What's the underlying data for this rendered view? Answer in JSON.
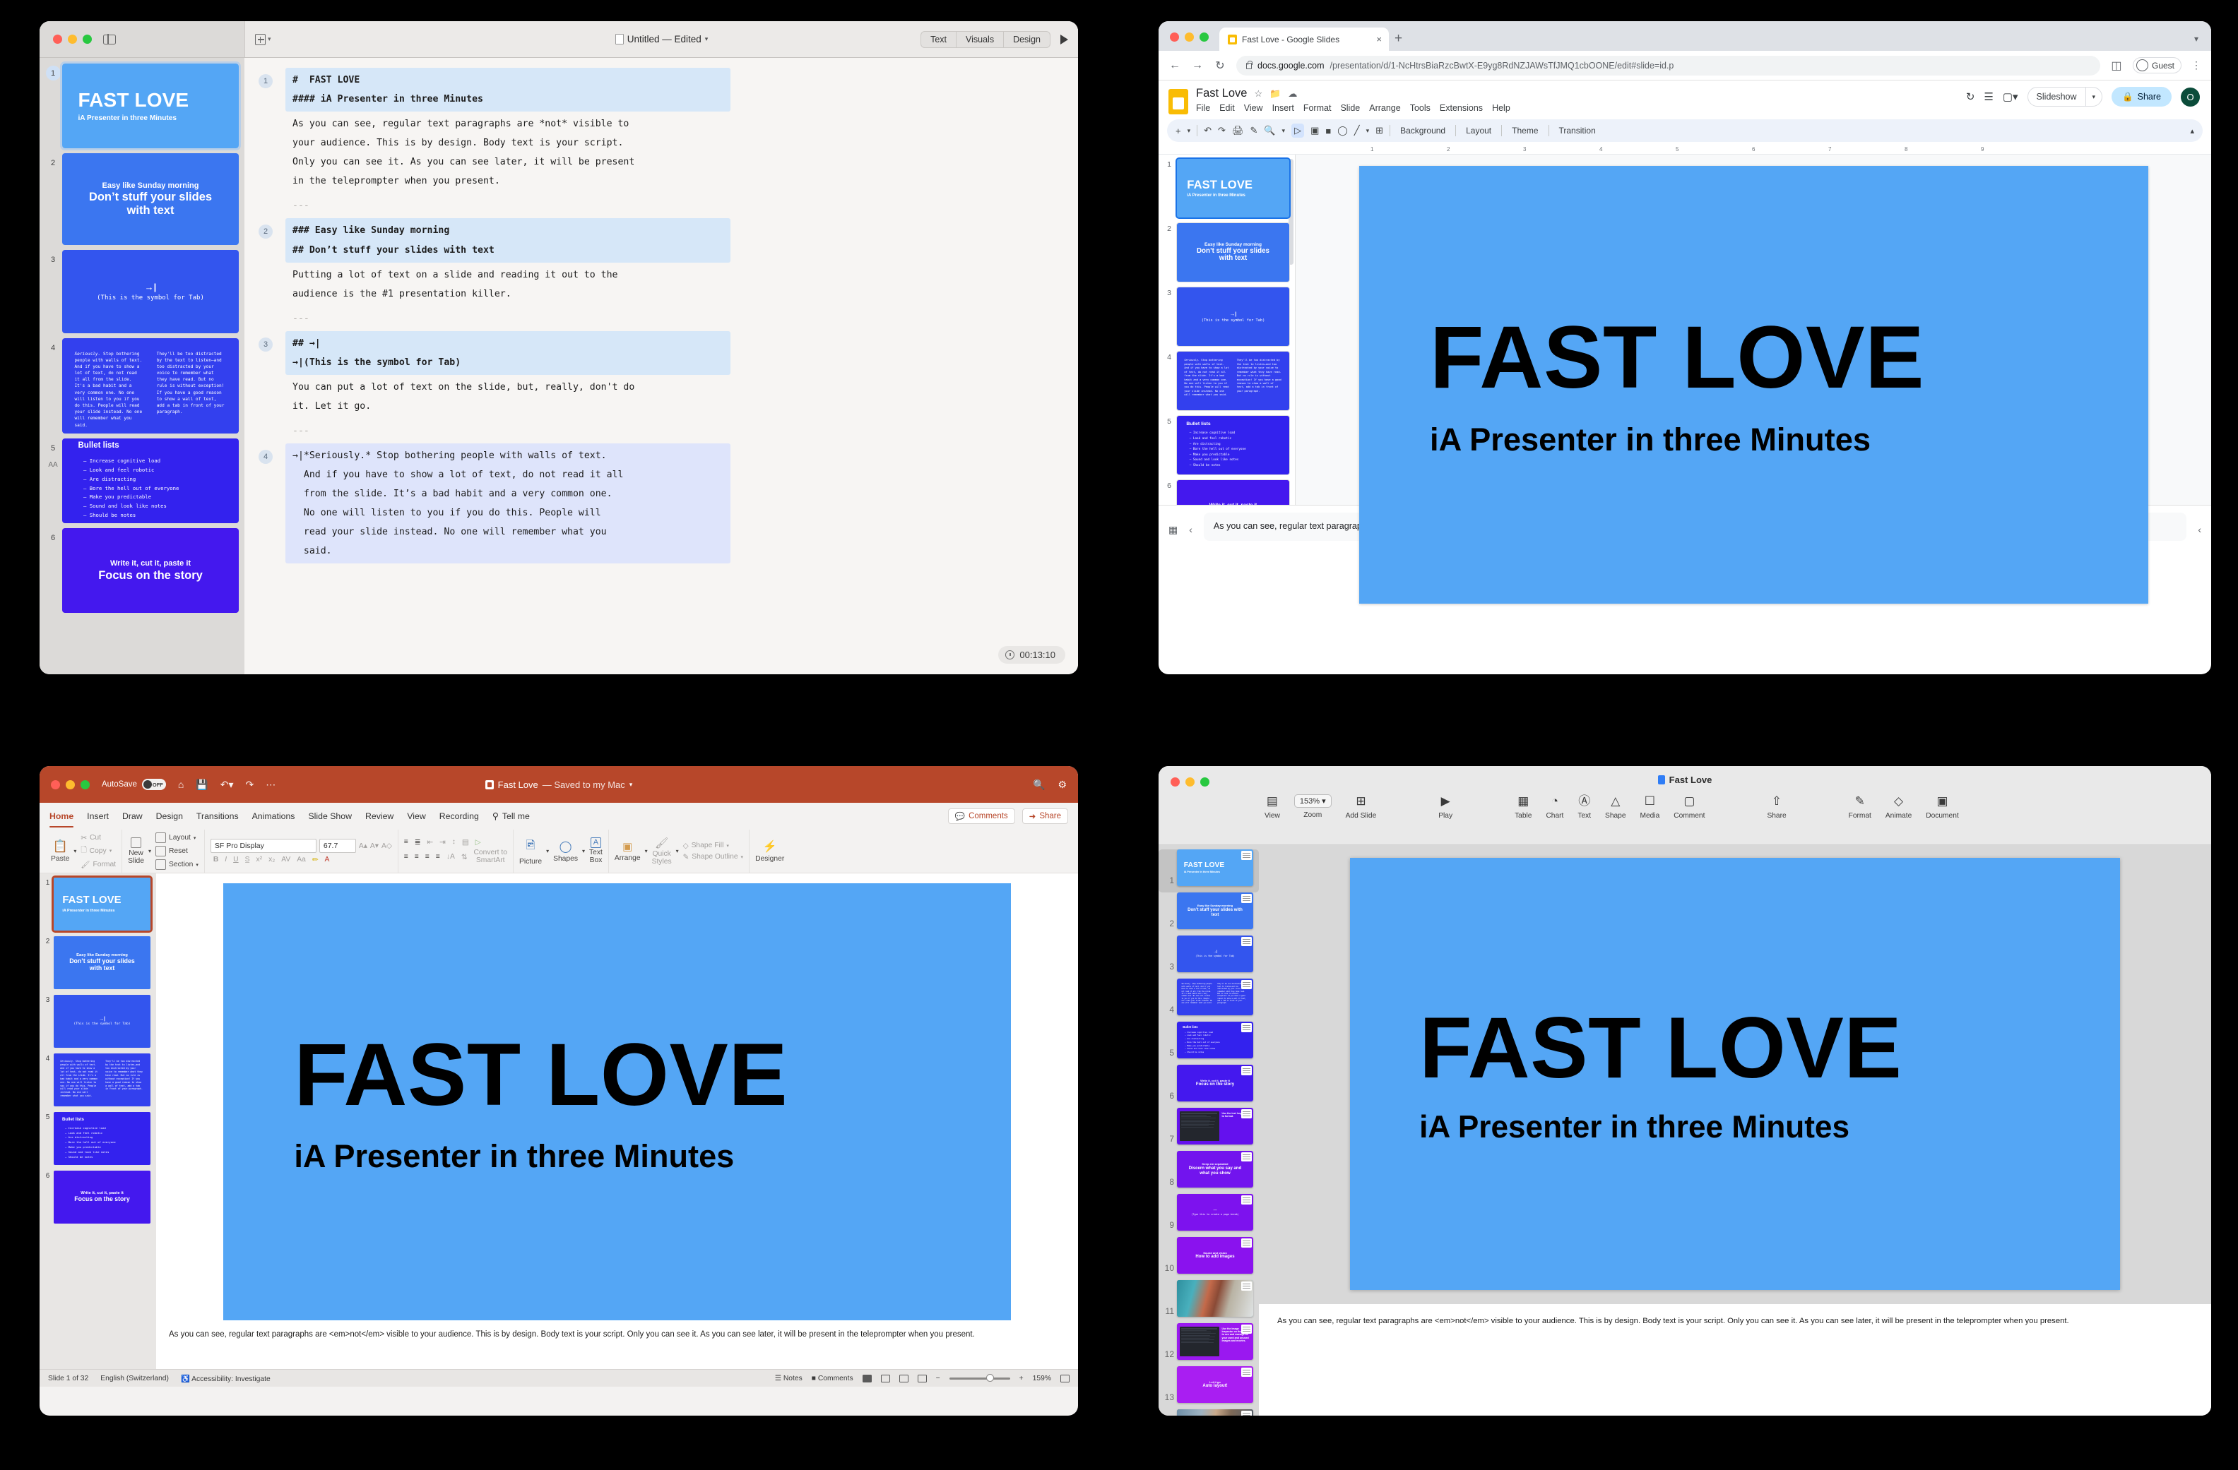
{
  "deck": {
    "slides": [
      {
        "n": 1,
        "bg": "#54a6f5",
        "kind": "title",
        "title": "FAST LOVE",
        "subtitle": "iA Presenter in three Minutes"
      },
      {
        "n": 2,
        "bg": "#3b76f0",
        "kind": "two-heading",
        "small": "Easy like Sunday morning",
        "big": "Don’t stuff your slides with text"
      },
      {
        "n": 3,
        "bg": "#3355ee",
        "kind": "tab",
        "symbol": "→|",
        "caption": "(This is the symbol for Tab)"
      },
      {
        "n": 4,
        "bg": "#3340ee",
        "kind": "two-col",
        "left": "Seriously. Stop bothering people with walls of text. And if you have to show a lot of text, do not read it all from the slide. It's a bad habit and a very common one. No one will listen to you if you do this. People will read your slide instead. No one will remember what you said.",
        "right": "They'll be too distracted by the text to listen—and too distracted by your voice to remember what they have read. But no rule is without exception! If you have a good reason to show a wall of text, add a tab in front of your paragraph."
      },
      {
        "n": 5,
        "bg": "#3322ee",
        "kind": "bullets",
        "heading": "Bullet lists",
        "items": [
          "Increase cognitive load",
          "Look and feel robotic",
          "Are distracting",
          "Bore the hell out of everyone",
          "Make you predictable",
          "Sound and look like notes",
          "Should be notes"
        ]
      },
      {
        "n": 6,
        "bg": "#4418ee",
        "kind": "two-heading",
        "small": "Write it, cut it, paste it",
        "big": "Focus on the story"
      },
      {
        "n": 7,
        "bg": "#6411ee",
        "kind": "dark-split",
        "text": "Use the text Inspector to format."
      },
      {
        "n": 8,
        "bg": "#7214ee",
        "kind": "two-heading",
        "small": "Keep em separated",
        "big": "Discern what you say and what you show"
      },
      {
        "n": 9,
        "bg": "#7d12ee",
        "kind": "tab",
        "symbol": "---",
        "caption": "(Type this to create a page break)"
      },
      {
        "n": 10,
        "bg": "#8a12ee",
        "kind": "two-heading",
        "small": "Sound and vision",
        "big": "How to add images"
      },
      {
        "n": 11,
        "bg": "#3a7f8c",
        "kind": "photo",
        "photo": "bridge"
      },
      {
        "n": 12,
        "bg": "#9a18f0",
        "kind": "dark-split",
        "text": "Use the image Inspector on the right to see and manage all your used and unused images and movies."
      },
      {
        "n": 13,
        "bg": "#a91ef2",
        "kind": "two-heading",
        "small": "Let it go",
        "big": "Auto layout!"
      },
      {
        "n": 14,
        "bg": "#4a6d80",
        "kind": "photo",
        "photo": "city"
      }
    ]
  },
  "ia": {
    "window_name": "iA Presenter",
    "titlebar": {
      "new_doc_label": "",
      "doc_title": "Untitled — Edited",
      "segments": [
        "Text",
        "Visuals",
        "Design"
      ],
      "play_icon": "play-icon"
    },
    "timer": "00:13:10",
    "editor": {
      "blocks": [
        {
          "num": "1",
          "hl": true,
          "lines": [
            "#  FAST LOVE",
            "#### iA Presenter in three Minutes"
          ]
        },
        {
          "num": "",
          "hl": false,
          "lines": [
            "As you can see, regular text paragraphs are *not* visible to",
            "your audience. This is by design. Body text is your script.",
            "Only you can see it. As you can see later, it will be present",
            "in the teleprompter when you present."
          ]
        },
        {
          "num": "",
          "hl": false,
          "lines": [
            "---"
          ],
          "dim": true
        },
        {
          "num": "2",
          "hl": true,
          "lines": [
            "### Easy like Sunday morning",
            "## Don’t stuff your slides with text"
          ]
        },
        {
          "num": "",
          "hl": false,
          "lines": [
            "Putting a lot of text on a slide and reading it out to the",
            "audience is the #1 presentation killer."
          ]
        },
        {
          "num": "",
          "hl": false,
          "lines": [
            "---"
          ],
          "dim": true
        },
        {
          "num": "3",
          "hl": true,
          "lines": [
            "## →|",
            "→|(This is the symbol for Tab)"
          ]
        },
        {
          "num": "",
          "hl": false,
          "lines": [
            "You can put a lot of text on the slide, but, really, don't do",
            "it. Let it go."
          ]
        },
        {
          "num": "",
          "hl": false,
          "lines": [
            "---"
          ],
          "dim": true
        },
        {
          "num": "4",
          "hl2": true,
          "lines": [
            "→|*Seriously.* Stop bothering people with walls of text.",
            "  And if you have to show a lot of text, do not read it all",
            "  from the slide. It’s a bad habit and a very common one.",
            "  No one will listen to you if you do this. People will",
            "  read your slide instead. No one will remember what you",
            "  said."
          ]
        }
      ]
    }
  },
  "gs": {
    "window_name": "Google Chrome — Google Slides",
    "browser": {
      "tab_title": "Fast Love - Google Slides",
      "tab_close": "×",
      "new_tab": "+",
      "back": "←",
      "forward": "→",
      "reload": "↻",
      "url": "docs.google.com",
      "url_path": "/presentation/d/1-NcHtrsBiaRzcBwtX-E9yg8RdNZJAWsTfJMQ1cbOONE/edit#slide=id.p",
      "profile": "Guest",
      "menu": "⋮"
    },
    "app": {
      "doc_title": "Fast Love",
      "menus": [
        "File",
        "Edit",
        "View",
        "Insert",
        "Format",
        "Slide",
        "Arrange",
        "Tools",
        "Extensions",
        "Help"
      ],
      "slideshow_label": "Slideshow",
      "share_label": "Share",
      "avatar_initial": "O",
      "toolbar_labels": [
        "Background",
        "Layout",
        "Theme",
        "Transition"
      ],
      "ruler_ticks": [
        "1",
        "2",
        "3",
        "4",
        "5",
        "6",
        "7",
        "8",
        "9"
      ],
      "notes": "As you can see, regular text paragraphs are <em>not</em> visible to your audience. This is by design. Body text is your script. Only you can see it. As you can see later, it will be present in the teleprompter when you present."
    }
  },
  "pp": {
    "window_name": "Microsoft PowerPoint",
    "titlebar": {
      "autosave_label": "AutoSave",
      "toggle_state": "OFF",
      "doc_name": "Fast Love",
      "doc_status": "— Saved to my Mac",
      "search_icon": "search-icon",
      "settings_icon": "gear-icon"
    },
    "tabs": [
      "Home",
      "Insert",
      "Draw",
      "Design",
      "Transitions",
      "Animations",
      "Slide Show",
      "Review",
      "View",
      "Recording"
    ],
    "tell_me": "Tell me",
    "comments_label": "Comments",
    "share_label": "Share",
    "ribbon": {
      "paste": "Paste",
      "cut": "Cut",
      "copy": "Copy",
      "format": "Format",
      "new_slide": "New\nSlide",
      "layout": "Layout",
      "reset": "Reset",
      "section": "Section",
      "font_name": "SF Pro Display",
      "font_size": "67.7",
      "convert": "Convert to\nSmartArt",
      "picture": "Picture",
      "shapes": "Shapes",
      "textbox": "Text\nBox",
      "arrange": "Arrange",
      "quick_styles": "Quick\nStyles",
      "shape_fill": "Shape Fill",
      "shape_outline": "Shape Outline",
      "designer": "Designer"
    },
    "status": {
      "slide_count": "Slide 1 of 32",
      "language": "English (Switzerland)",
      "accessibility": "Accessibility: Investigate",
      "notes": "Notes",
      "comments": "Comments",
      "zoom": "159%"
    },
    "notes": "As you can see, regular text paragraphs are <em>not</em> visible to your audience. This is by design. Body text is your script. Only you can see it. As you can see later, it will be present in the teleprompter when you present."
  },
  "kn": {
    "window_name": "Apple Keynote",
    "doc_title": "Fast Love",
    "toolbar": [
      {
        "label": "View",
        "icon": "view-icon"
      },
      {
        "label": "Zoom",
        "icon": "zoom-value",
        "value": "153%"
      },
      {
        "label": "Add Slide",
        "icon": "add-slide-icon"
      },
      {
        "label": "Play",
        "icon": "play-icon"
      },
      {
        "label": "Table",
        "icon": "table-icon"
      },
      {
        "label": "Chart",
        "icon": "chart-icon"
      },
      {
        "label": "Text",
        "icon": "text-icon"
      },
      {
        "label": "Shape",
        "icon": "shape-icon"
      },
      {
        "label": "Media",
        "icon": "media-icon"
      },
      {
        "label": "Comment",
        "icon": "comment-icon"
      },
      {
        "label": "Share",
        "icon": "share-icon"
      },
      {
        "label": "Format",
        "icon": "format-icon"
      },
      {
        "label": "Animate",
        "icon": "animate-icon"
      },
      {
        "label": "Document",
        "icon": "document-icon"
      }
    ],
    "notes": "As you can see, regular text paragraphs are <em>not</em> visible to your audience. This is by design. Body text is your script. Only you can see it. As you can see later, it will be present in the teleprompter when you present."
  }
}
